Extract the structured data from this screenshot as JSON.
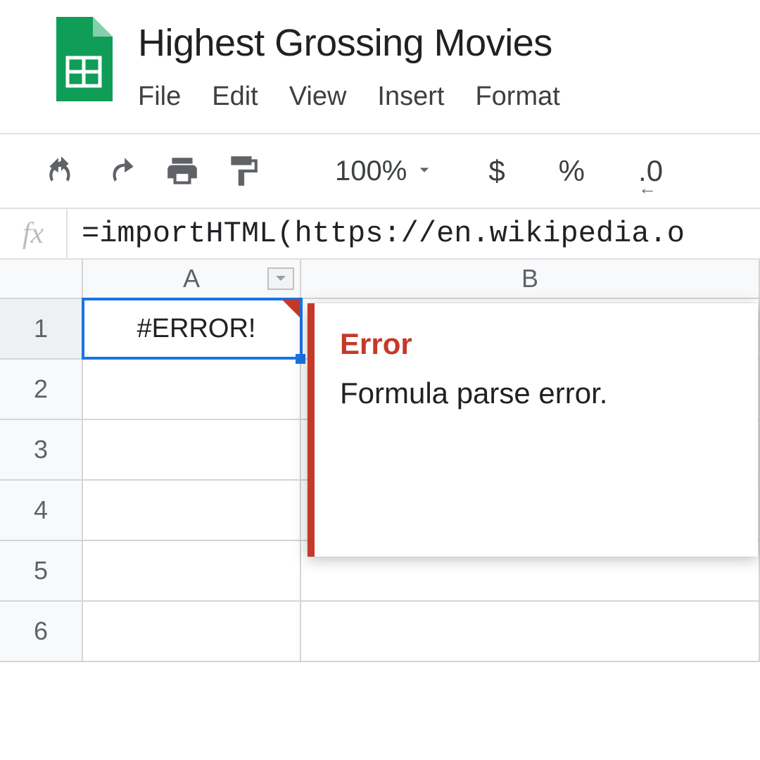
{
  "doc": {
    "title": "Highest Grossing Movies"
  },
  "menu": {
    "file": "File",
    "edit": "Edit",
    "view": "View",
    "insert": "Insert",
    "format": "Format"
  },
  "toolbar": {
    "zoom": "100%",
    "currency_symbol": "$",
    "percent_symbol": "%",
    "decimal_symbol": ".0"
  },
  "formula_bar": {
    "fx_label": "fx",
    "formula": "=importHTML(https://en.wikipedia.o"
  },
  "columns": {
    "a": "A",
    "b": "B"
  },
  "rows": [
    "1",
    "2",
    "3",
    "4",
    "5",
    "6"
  ],
  "cells": {
    "a1": "#ERROR!"
  },
  "error_popup": {
    "title": "Error",
    "message": "Formula parse error."
  }
}
